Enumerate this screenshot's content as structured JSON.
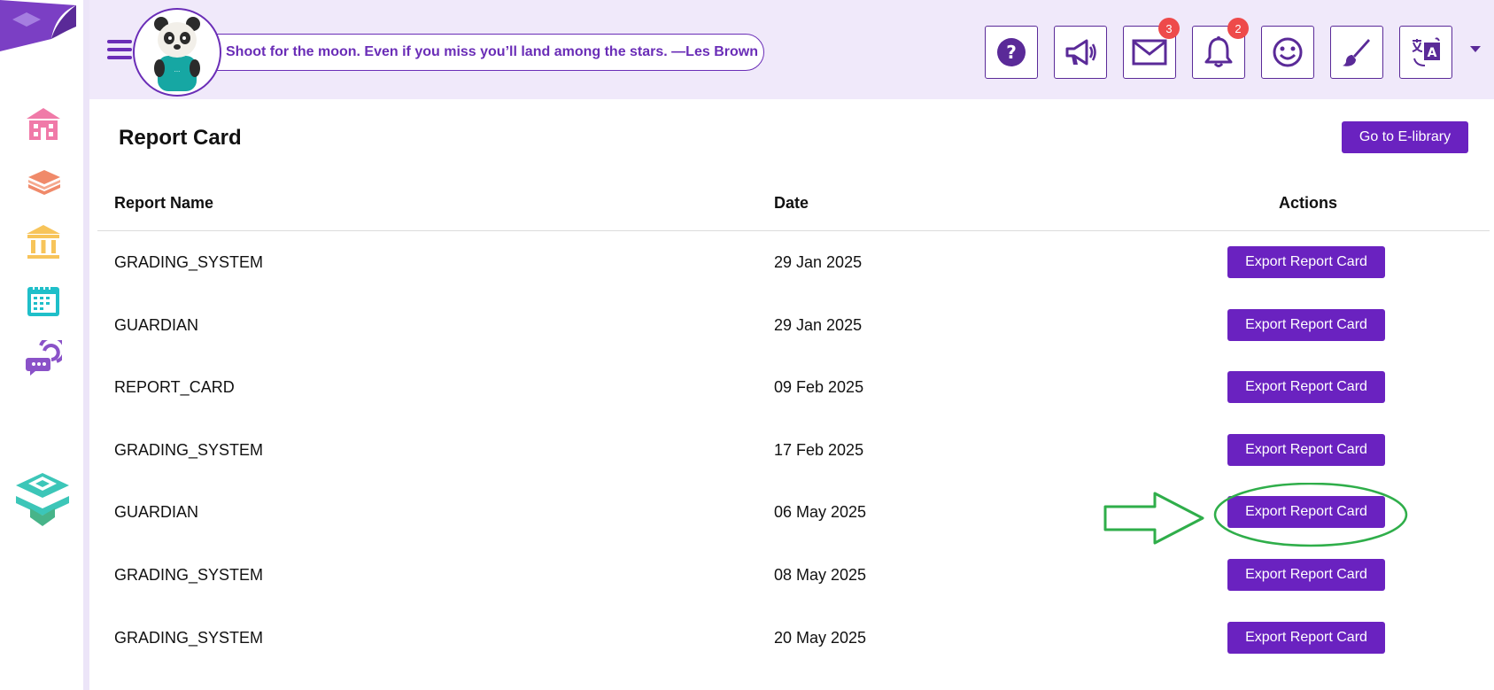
{
  "header": {
    "quote": "Shoot for the moon. Even if you miss you’ll land among the stars. —Les Brown",
    "buttons": [
      {
        "icon": "help-icon"
      },
      {
        "icon": "megaphone-icon"
      },
      {
        "icon": "mail-icon",
        "badge": "3"
      },
      {
        "icon": "bell-icon",
        "badge": "2"
      },
      {
        "icon": "smiley-icon"
      },
      {
        "icon": "brush-icon"
      },
      {
        "icon": "translate-icon"
      }
    ]
  },
  "sidebar": {
    "items": [
      {
        "icon": "school-icon",
        "color": "#f07aa8"
      },
      {
        "icon": "books-icon",
        "color": "#f08a6a"
      },
      {
        "icon": "institution-icon",
        "color": "#f7c45a"
      },
      {
        "icon": "calendar-icon",
        "color": "#1fbfc9"
      },
      {
        "icon": "chat-icon",
        "color": "#8a52c8"
      }
    ]
  },
  "page": {
    "title": "Report Card",
    "elibrary_label": "Go to E-library"
  },
  "table": {
    "headers": [
      "Report Name",
      "Date",
      "Actions"
    ],
    "rows": [
      {
        "name": "GRADING_SYSTEM",
        "date": "29 Jan 2025",
        "action": "Export Report Card"
      },
      {
        "name": "GUARDIAN",
        "date": "29 Jan 2025",
        "action": "Export Report Card"
      },
      {
        "name": "REPORT_CARD",
        "date": "09 Feb 2025",
        "action": "Export Report Card"
      },
      {
        "name": "GRADING_SYSTEM",
        "date": "17 Feb 2025",
        "action": "Export Report Card"
      },
      {
        "name": "GUARDIAN",
        "date": "06 May 2025",
        "action": "Export Report Card"
      },
      {
        "name": "GRADING_SYSTEM",
        "date": "08 May 2025",
        "action": "Export Report Card"
      },
      {
        "name": "GRADING_SYSTEM",
        "date": "20 May 2025",
        "action": "Export Report Card"
      }
    ]
  },
  "colors": {
    "accent": "#6a22c0",
    "header_bg": "#f0e9fa",
    "badge": "#ee4a4a",
    "annotation": "#2fae4a"
  }
}
